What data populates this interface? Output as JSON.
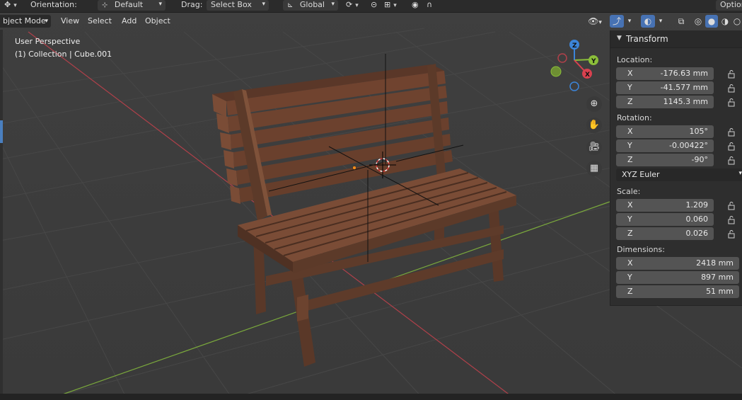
{
  "header": {
    "orientation_label": "Orientation:",
    "orientation_value": "Default",
    "drag_label": "Drag:",
    "drag_value": "Select Box",
    "transform_space": "Global",
    "options_label": "Option"
  },
  "menu": {
    "mode": "bject Mode",
    "view": "View",
    "select": "Select",
    "add": "Add",
    "object": "Object"
  },
  "viewport": {
    "perspective_label": "User Perspective",
    "collection_label": "(1) Collection | Cube.001",
    "gizmo_axes": [
      "Z",
      "Y",
      "X"
    ]
  },
  "panel": {
    "title": "Transform",
    "location_label": "Location:",
    "location": [
      {
        "axis": "X",
        "value": "-176.63 mm"
      },
      {
        "axis": "Y",
        "value": "-41.577 mm"
      },
      {
        "axis": "Z",
        "value": "1145.3 mm"
      }
    ],
    "rotation_label": "Rotation:",
    "rotation": [
      {
        "axis": "X",
        "value": "105°"
      },
      {
        "axis": "Y",
        "value": "-0.00422°"
      },
      {
        "axis": "Z",
        "value": "-90°"
      }
    ],
    "rotation_mode": "XYZ Euler",
    "scale_label": "Scale:",
    "scale": [
      {
        "axis": "X",
        "value": "1.209"
      },
      {
        "axis": "Y",
        "value": "0.060"
      },
      {
        "axis": "Z",
        "value": "0.026"
      }
    ],
    "dimensions_label": "Dimensions:",
    "dimensions": [
      {
        "axis": "X",
        "value": "2418 mm"
      },
      {
        "axis": "Y",
        "value": "897 mm"
      },
      {
        "axis": "Z",
        "value": "51 mm"
      }
    ]
  },
  "colors": {
    "axis_x": "#d9414f",
    "axis_y": "#8bbf3a",
    "axis_z": "#3c85d9",
    "wood": "#6b4230",
    "background": "#3d3d3d",
    "panel": "#2e2e2e"
  }
}
